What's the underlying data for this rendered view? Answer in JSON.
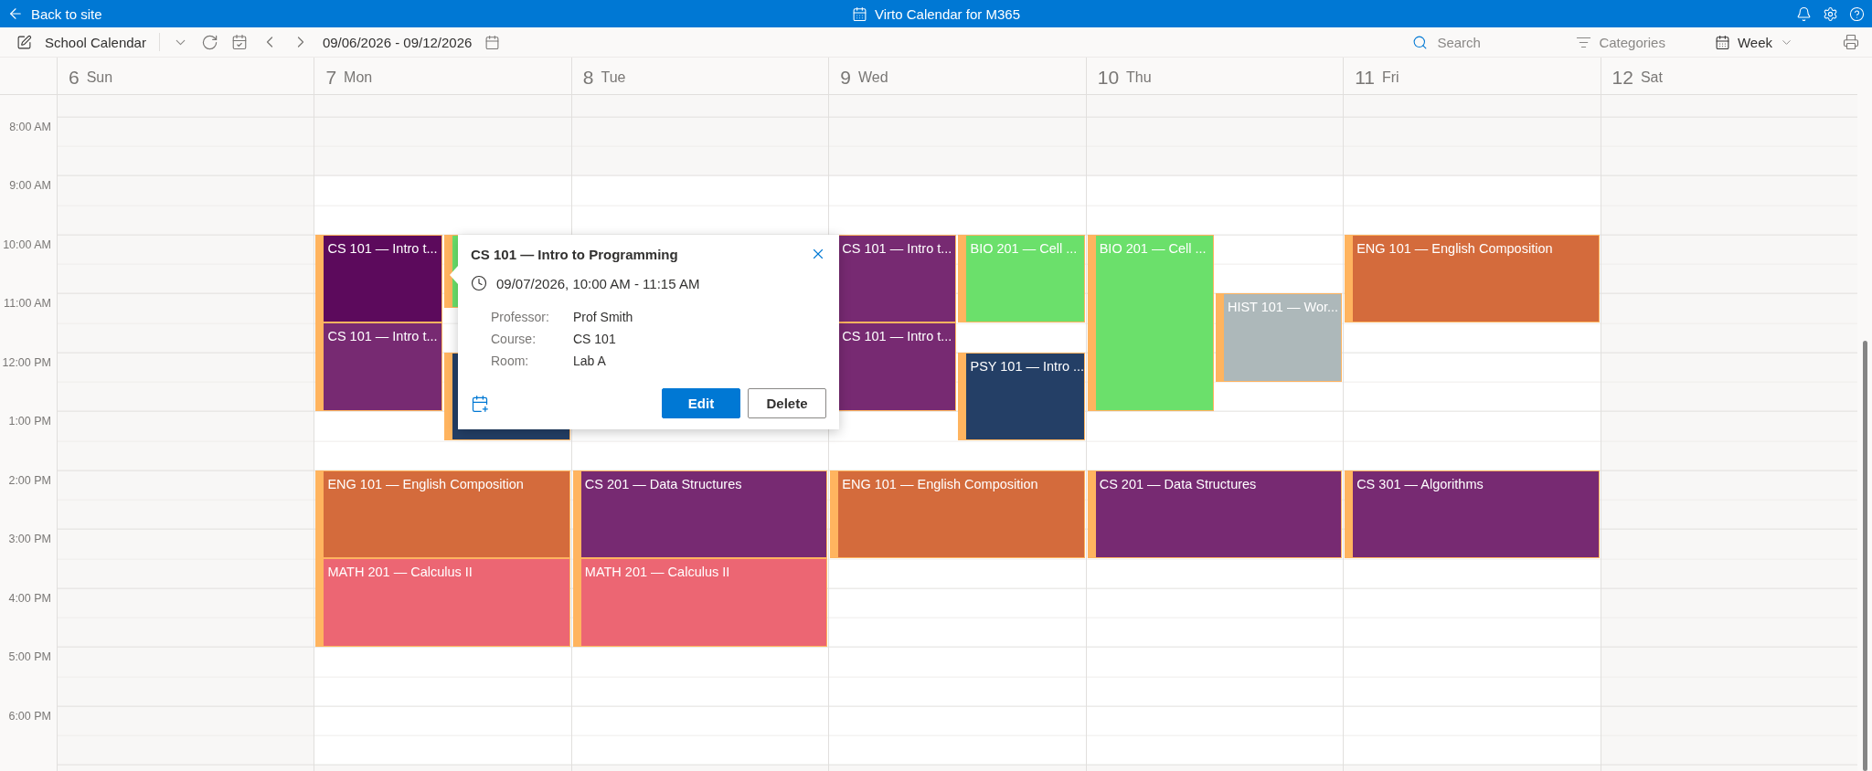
{
  "top_bar": {
    "back_link": "Back to site",
    "title": "Virto Calendar for M365"
  },
  "toolbar": {
    "calendar_name": "School Calendar",
    "date_range": "09/06/2026 - 09/12/2026",
    "search": {
      "placeholder": "Search"
    },
    "categories": "Categories",
    "view": "Week"
  },
  "calendar": {
    "time_labels": [
      "8:00 AM",
      "9:00 AM",
      "10:00 AM",
      "11:00 AM",
      "12:00 PM",
      "1:00 PM",
      "2:00 PM",
      "3:00 PM",
      "4:00 PM",
      "5:00 PM",
      "6:00 PM"
    ],
    "days": [
      {
        "number": "6",
        "name": "Sun",
        "kind": "weekend"
      },
      {
        "number": "7",
        "name": "Mon",
        "kind": "weekday",
        "groups": [
          {
            "lanes": [
              [
                {
                  "title": "CS 101 — Intro t...",
                  "color": "#5c0a5c"
                },
                {
                  "title": "CS 101 — Intro t...",
                  "color": "#772a72"
                }
              ],
              [
                {
                  "color": "#6be06b"
                },
                {
                  "color": "#243f66"
                }
              ]
            ]
          },
          {
            "lanes": [
              [
                {
                  "title": "ENG 101 — English Composition",
                  "color": "#d46b3c"
                },
                {
                  "title": "MATH 201 — Calculus II",
                  "color": "#ec6673"
                }
              ]
            ]
          }
        ]
      },
      {
        "number": "8",
        "name": "Tue",
        "kind": "weekday",
        "groups": [
          {
            "lanes": [
              [
                {
                  "title": "CS 201 — Data Structures",
                  "color": "#772a72"
                },
                {
                  "title": "MATH 201 — Calculus II",
                  "color": "#ec6673"
                }
              ]
            ]
          }
        ]
      },
      {
        "number": "9",
        "name": "Wed",
        "kind": "weekday",
        "groups": [
          {
            "lanes": [
              [
                {
                  "title": "CS 101 — Intro t...",
                  "color": "#772a72"
                },
                {
                  "title": "CS 101 — Intro t...",
                  "color": "#772a72"
                }
              ],
              [
                {
                  "title": "BIO 201 — Cell ...",
                  "color": "#6be06b"
                },
                {
                  "title": "PSY 101 — Intro ...",
                  "color": "#243f66"
                }
              ]
            ]
          },
          {
            "lanes": [
              [
                {
                  "title": "ENG 101 — English Composition",
                  "color": "#d46b3c"
                }
              ]
            ]
          }
        ]
      },
      {
        "number": "10",
        "name": "Thu",
        "kind": "weekday",
        "groups": [
          {
            "lanes": [
              [
                {
                  "title": "BIO 201 — Cell ...",
                  "color": "#6be06b"
                }
              ],
              [
                {
                  "title": "HIST 101 — Wor...",
                  "color": "#adb8ba"
                }
              ]
            ]
          },
          {
            "lanes": [
              [
                {
                  "title": "CS 201 — Data Structures",
                  "color": "#772a72"
                }
              ]
            ]
          }
        ]
      },
      {
        "number": "11",
        "name": "Fri",
        "kind": "weekday",
        "groups": [
          {
            "lanes": [
              [
                {
                  "title": "ENG 101 — English Composition",
                  "color": "#d46b3c"
                }
              ]
            ]
          },
          {
            "lanes": [
              [
                {
                  "title": "CS 301 — Algorithms",
                  "color": "#772a72"
                }
              ]
            ]
          }
        ]
      },
      {
        "number": "12",
        "name": "Sat",
        "kind": "weekend"
      }
    ]
  },
  "popup": {
    "title": "CS 101 — Intro to Programming",
    "when": "09/07/2026, 10:00 AM - 11:15 AM",
    "fields": [
      {
        "label": "Professor:",
        "value": "Prof Smith"
      },
      {
        "label": "Course:",
        "value": "CS 101"
      },
      {
        "label": "Room:",
        "value": "Lab A"
      }
    ],
    "buttons": [
      "Edit",
      "Delete"
    ]
  }
}
